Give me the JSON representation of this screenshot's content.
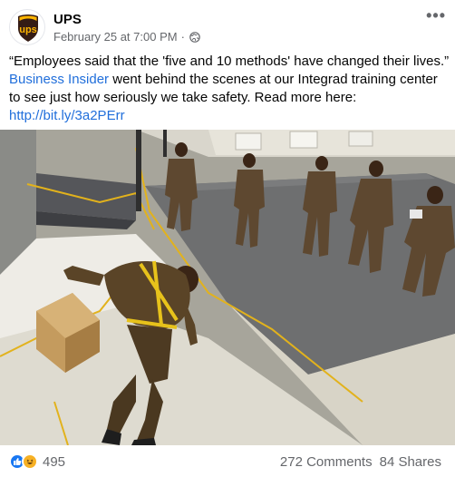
{
  "post": {
    "page_name": "UPS",
    "date": "February 25 at 7:00 PM",
    "separator": "·",
    "audience_icon": "globe-icon",
    "more_icon": "more-options-icon",
    "more_glyph": "•••",
    "avatar_logo_text": "ups",
    "caption": {
      "text_1": "“Employees said that the 'five and 10 methods' have changed their lives.”",
      "link_1": "Business Insider",
      "text_2": " went behind the scenes at our Integrad training center to see just how seriously we take safety. Read more here: ",
      "link_2": "http://bit.ly/3a2PErr"
    }
  },
  "footer": {
    "reaction_icons": [
      "like-icon",
      "haha-icon"
    ],
    "reaction_count": "495",
    "comments": "272 Comments",
    "shares": "84 Shares"
  },
  "colors": {
    "ups_brown": "#351c15",
    "ups_gold": "#ffb500",
    "link": "#216fdb",
    "muted": "#65676b"
  }
}
